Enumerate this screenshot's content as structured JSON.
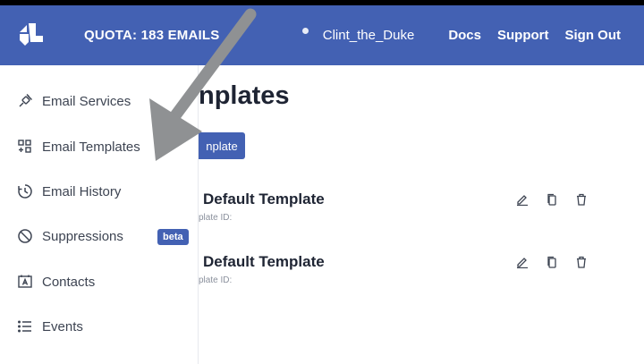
{
  "topbar": {
    "quota": "QUOTA: 183 EMAILS",
    "username": "Clint_the_Duke",
    "links": [
      "Docs",
      "Support",
      "Sign Out"
    ],
    "background": "#4361b3"
  },
  "sidebar": {
    "items": [
      {
        "label": "Email Services",
        "icon": "plug-icon"
      },
      {
        "label": "Email Templates",
        "icon": "templates-icon"
      },
      {
        "label": "Email History",
        "icon": "history-icon"
      },
      {
        "label": "Suppressions",
        "icon": "block-icon"
      },
      {
        "label": "Contacts",
        "icon": "contacts-icon"
      },
      {
        "label": "Events",
        "icon": "list-icon"
      }
    ],
    "beta_badge": "beta"
  },
  "main": {
    "title": "nplates",
    "new_button": "nplate",
    "templates": [
      {
        "name": "Default Template",
        "id_label": "plate ID:"
      },
      {
        "name": "Default Template",
        "id_label": "plate ID:"
      }
    ]
  },
  "colors": {
    "accent": "#4361b3",
    "arrow": "#8f9193"
  }
}
